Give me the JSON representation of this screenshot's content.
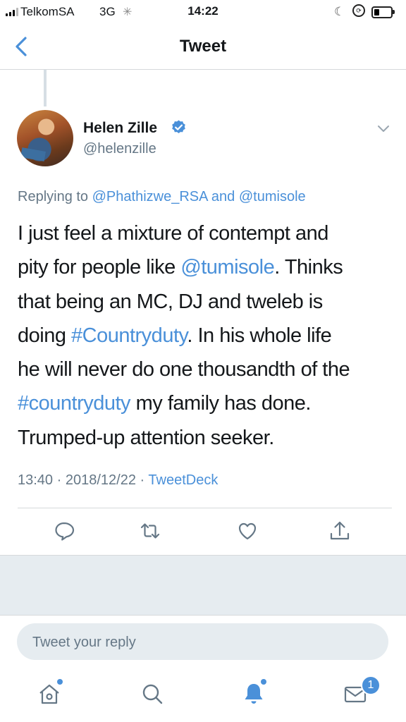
{
  "status_bar": {
    "carrier": "TelkomSA",
    "network": "3G",
    "time": "14:22"
  },
  "nav": {
    "title": "Tweet"
  },
  "tweet": {
    "author_name": "Helen Zille",
    "author_handle": "@helenzille",
    "replying_prefix": "Replying to",
    "replying_user1": "@Phathizwe_RSA",
    "replying_and": "and",
    "replying_user2": "@tumisole",
    "body": {
      "l1": "I just feel a mixture of contempt and",
      "l2_pre": "pity for people like ",
      "l2_mention": "@tumisole",
      "l2_post": ".  Thinks",
      "l3": "that being an MC, DJ and tweleb is",
      "l4_pre": "doing ",
      "l4_tag": "#Countryduty",
      "l4_post": ".  In his whole life",
      "l5": "he will never do one thousandth of the",
      "l6_tag": "#countryduty",
      "l6_post": " my family has done.",
      "l7": "Trumped-up attention seeker."
    },
    "time": "13:40",
    "date": "2018/12/22",
    "separator": "·",
    "source": "TweetDeck"
  },
  "reply": {
    "placeholder": "Tweet your reply"
  },
  "tabbar": {
    "messages_badge": "1"
  },
  "colors": {
    "accent": "#4a90d9",
    "secondary_text": "#657786",
    "primary_text": "#14171a",
    "divider": "#d6d9db",
    "band": "#e6ecf0"
  },
  "icons": {
    "back": "chevron-left-icon",
    "verified": "verified-badge-icon",
    "more": "chevron-down-icon",
    "reply": "comment-icon",
    "retweet": "retweet-icon",
    "like": "heart-icon",
    "share": "share-icon",
    "home": "home-icon",
    "search": "search-icon",
    "notifications": "bell-icon",
    "messages": "mail-icon"
  }
}
